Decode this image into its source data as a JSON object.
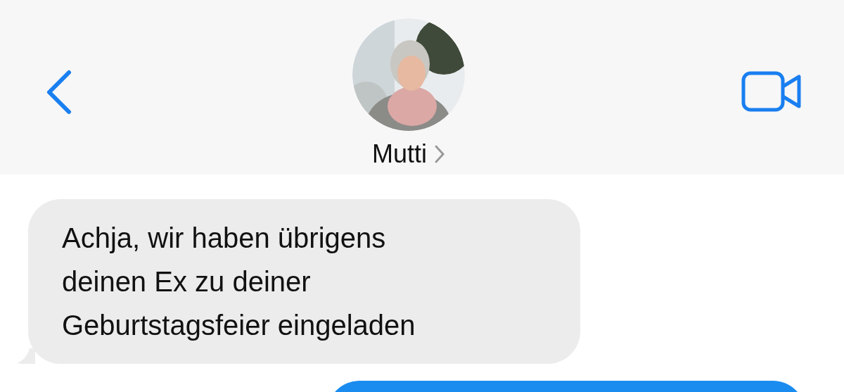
{
  "header": {
    "contact": {
      "name": "Mutti"
    }
  },
  "messages": [
    {
      "kind": "received",
      "text": "Achja, wir haben übrigens deinen Ex zu deiner Geburtstagsfeier eingeladen"
    },
    {
      "kind": "sent"
    }
  ]
}
